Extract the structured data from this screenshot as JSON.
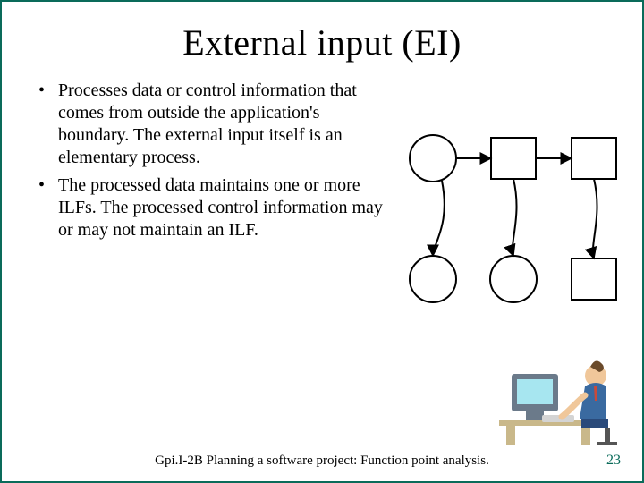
{
  "title": "External input (EI)",
  "bullets": [
    "Processes data or control information that comes from outside the application's boundary.  The external input itself is an elementary process.",
    "The processed data maintains one or more ILFs.  The processed control information may or may not maintain an ILF."
  ],
  "footer": "Gpi.I-2B Planning a software project: Function point analysis.",
  "page_number": "23"
}
